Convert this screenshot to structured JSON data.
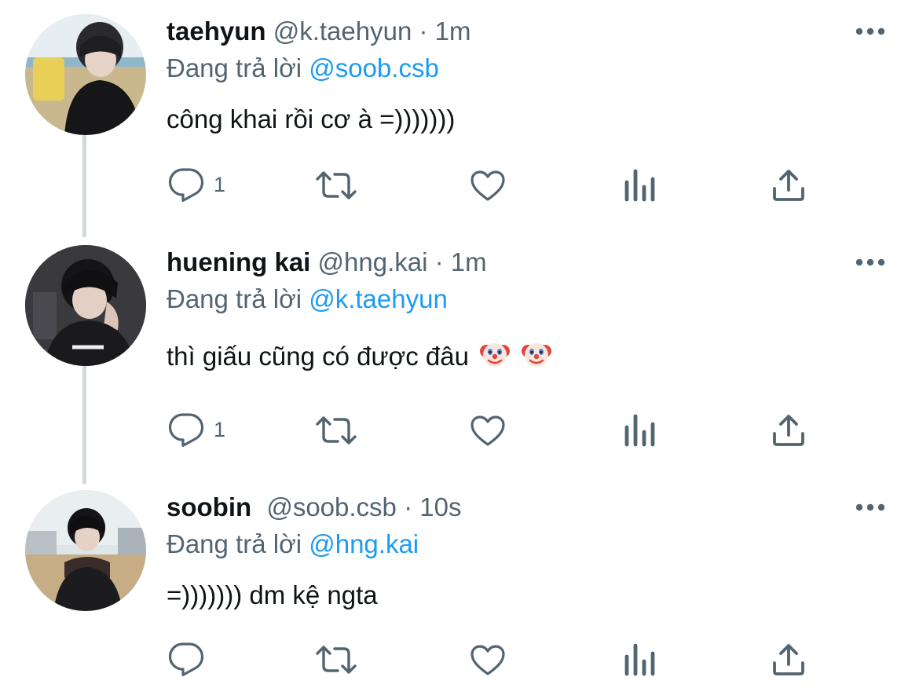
{
  "colors": {
    "text": "#0f1419",
    "secondary": "#536471",
    "mention": "#1d9bf0",
    "thread_line": "#cfd9de"
  },
  "tweets": [
    {
      "name": "taehyun",
      "handle": "@k.taehyun",
      "separator": "·",
      "time": "1m",
      "reply_prefix": "Đang trả lời",
      "reply_to": "@soob.csb",
      "text": "công khai rồi cơ à =)))))))",
      "reply_count": "1"
    },
    {
      "name": "huening kai",
      "handle": "@hng.kai",
      "separator": "·",
      "time": "1m",
      "reply_prefix": "Đang trả lời",
      "reply_to": "@k.taehyun",
      "text": "thì giấu cũng có được đâu",
      "emoji": [
        "clown-face",
        "clown-face"
      ],
      "reply_count": "1"
    },
    {
      "name": "soobin",
      "handle": "@soob.csb",
      "separator": "·",
      "time": "10s",
      "reply_prefix": "Đang trả lời",
      "reply_to": "@hng.kai",
      "text": "=))))))) dm kệ ngta",
      "reply_count": ""
    }
  ]
}
